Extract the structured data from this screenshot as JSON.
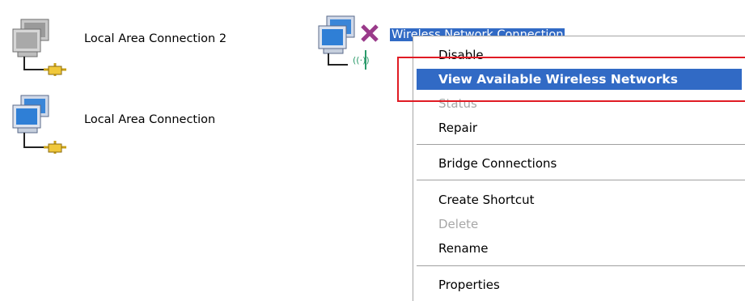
{
  "connections": [
    {
      "label": "Local Area Connection 2",
      "icon": "lan-computer-gray-icon"
    },
    {
      "label": "Local Area Connection",
      "icon": "lan-computer-blue-icon"
    },
    {
      "label": "Wireless Network Connection",
      "icon": "wireless-computer-disconnected-icon"
    }
  ],
  "context_menu": {
    "items": [
      {
        "label": "Disable",
        "state": "enabled"
      },
      {
        "label": "View Available Wireless Networks",
        "state": "highlighted"
      },
      {
        "label": "Status",
        "state": "disabled"
      },
      {
        "label": "Repair",
        "state": "enabled"
      },
      {
        "label": "Bridge Connections",
        "state": "enabled"
      },
      {
        "label": "Create Shortcut",
        "state": "enabled"
      },
      {
        "label": "Delete",
        "state": "disabled"
      },
      {
        "label": "Rename",
        "state": "enabled"
      },
      {
        "label": "Properties",
        "state": "enabled"
      }
    ]
  },
  "colors": {
    "selection": "#316ac5",
    "callout": "#e01b24",
    "disabled_text": "#a7a7a7"
  }
}
